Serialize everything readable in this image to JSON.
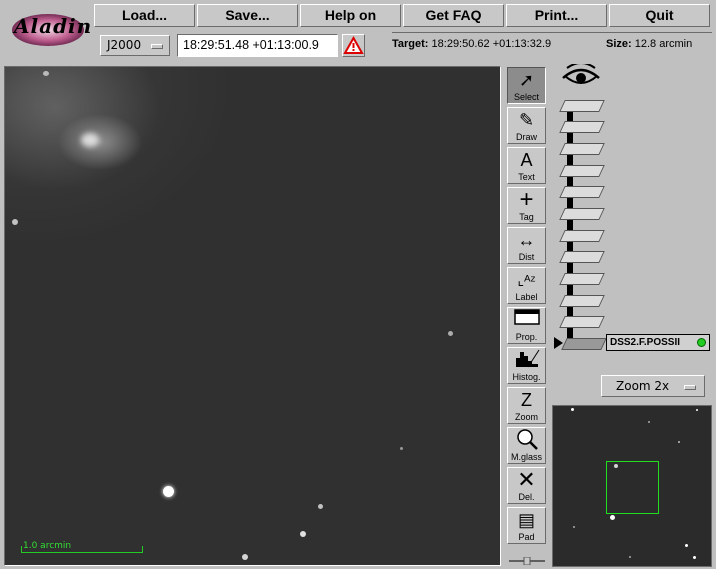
{
  "app": {
    "logo_text": "Aladin"
  },
  "menu": {
    "load": "Load...",
    "save": "Save...",
    "help": "Help on",
    "faq": "Get FAQ",
    "print": "Print...",
    "quit": "Quit"
  },
  "position": {
    "frame": "J2000",
    "coords": "18:29:51.48 +01:13:00.9"
  },
  "target": {
    "label": "Target:",
    "value": "18:29:50.62 +01:13:32.9",
    "size_label": "Size:",
    "size_value": "12.8 arcmin"
  },
  "view": {
    "scale_label": "1.0 arcmin"
  },
  "tools": [
    {
      "label": "Select",
      "icon": "arrow-icon"
    },
    {
      "label": "Draw",
      "icon": "pencil-icon"
    },
    {
      "label": "Text",
      "icon": "text-icon"
    },
    {
      "label": "Tag",
      "icon": "crosshair-icon"
    },
    {
      "label": "Dist",
      "icon": "distance-icon"
    },
    {
      "label": "Label",
      "icon": "label-icon"
    },
    {
      "label": "Prop.",
      "icon": "window-icon"
    },
    {
      "label": "Histog.",
      "icon": "histogram-icon"
    },
    {
      "label": "Zoom",
      "icon": "zoom-icon"
    },
    {
      "label": "M.glass",
      "icon": "magnifier-icon"
    },
    {
      "label": "Del.",
      "icon": "delete-icon"
    },
    {
      "label": "Pad",
      "icon": "notepad-icon"
    }
  ],
  "stack": {
    "plane_name": "DSS2.F.POSSII",
    "status_color": "#22cc22"
  },
  "zoom": {
    "level": "Zoom 2x"
  },
  "glyphs": {
    "select": "➚",
    "draw": "✎",
    "text": "A",
    "tag": "+",
    "dist": "↔",
    "label": "⌞ᴬᶻ",
    "del": "✕",
    "pad": "▤",
    "zoom": "Z",
    "mglass": "⌕",
    "hist": "▟",
    "warn": "⚠"
  }
}
